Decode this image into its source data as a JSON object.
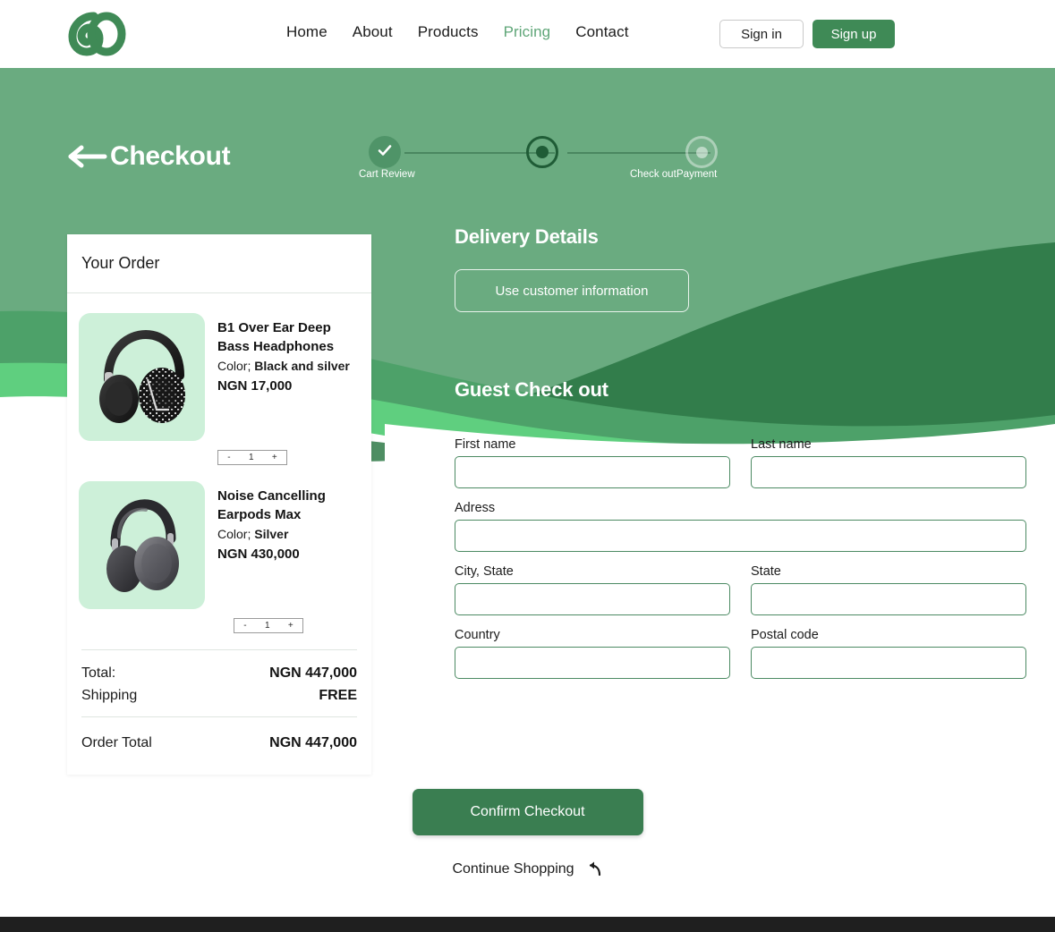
{
  "theme": {
    "brand_green": "#3f8a56",
    "hero_green": "#6aab80",
    "wave_dark": "#2f7a48",
    "wave_mid": "#4da169",
    "wave_light": "#5fcf7f",
    "accent_text": "#5fa678",
    "thumb_bg": "#cdf0d9",
    "footer_bar": "#1f1f1f"
  },
  "header": {
    "logo_name": "co-logo",
    "nav": [
      {
        "label": "Home",
        "active": false
      },
      {
        "label": "About",
        "active": false
      },
      {
        "label": "Products",
        "active": false
      },
      {
        "label": "Pricing",
        "active": true
      },
      {
        "label": "Contact",
        "active": false
      }
    ],
    "sign_in_label": "Sign in",
    "sign_up_label": "Sign  up"
  },
  "hero": {
    "back_icon": "arrow-left-icon",
    "title": "Checkout"
  },
  "stepper": {
    "steps": [
      {
        "label": "Cart Review",
        "state": "done",
        "icon": "check-icon"
      },
      {
        "label": "Check out",
        "state": "current",
        "icon": "dot-icon"
      },
      {
        "label": "Payment",
        "state": "todo",
        "icon": "dot-icon"
      }
    ]
  },
  "order": {
    "heading": "Your Order",
    "items": [
      {
        "name": "B1 Over Ear Deep Bass Headphones",
        "color_label": "Color;",
        "color_value": "Black and silver",
        "price": "NGN 17,000",
        "qty": "1",
        "minus": "-",
        "plus": "+",
        "image_name": "over-ear-headphones-image"
      },
      {
        "name": "Noise Cancelling Earpods Max",
        "color_label": "Color;",
        "color_value": "Silver",
        "price": "NGN 430,000",
        "qty": "1",
        "minus": "-",
        "plus": "+",
        "image_name": "earpods-max-image"
      }
    ],
    "totals": [
      {
        "label": "Total:",
        "value": "NGN 447,000"
      },
      {
        "label": "Shipping",
        "value": "FREE"
      }
    ],
    "grand_total": {
      "label": "Order Total",
      "value": "NGN 447,000"
    }
  },
  "delivery": {
    "title": "Delivery Details",
    "use_customer_info_label": "Use customer information"
  },
  "guest": {
    "title": "Guest Check out",
    "fields": [
      {
        "label": "First name",
        "value": "",
        "placeholder": "",
        "name": "first-name-field"
      },
      {
        "label": "Last name",
        "value": "",
        "placeholder": "",
        "name": "last-name-field"
      },
      {
        "label": "Adress",
        "value": "",
        "placeholder": "",
        "name": "address-field"
      },
      {
        "label": "City, State",
        "value": "",
        "placeholder": "",
        "name": "city-state-field"
      },
      {
        "label": "State",
        "value": "",
        "placeholder": "",
        "name": "state-field"
      },
      {
        "label": "Country",
        "value": "",
        "placeholder": "",
        "name": "country-field"
      },
      {
        "label": "Postal code",
        "value": "",
        "placeholder": "",
        "name": "postal-code-field"
      }
    ]
  },
  "actions": {
    "confirm_label": "Confirm Checkout",
    "continue_label": "Continue Shopping",
    "continue_icon": "undo-arrow-icon"
  }
}
